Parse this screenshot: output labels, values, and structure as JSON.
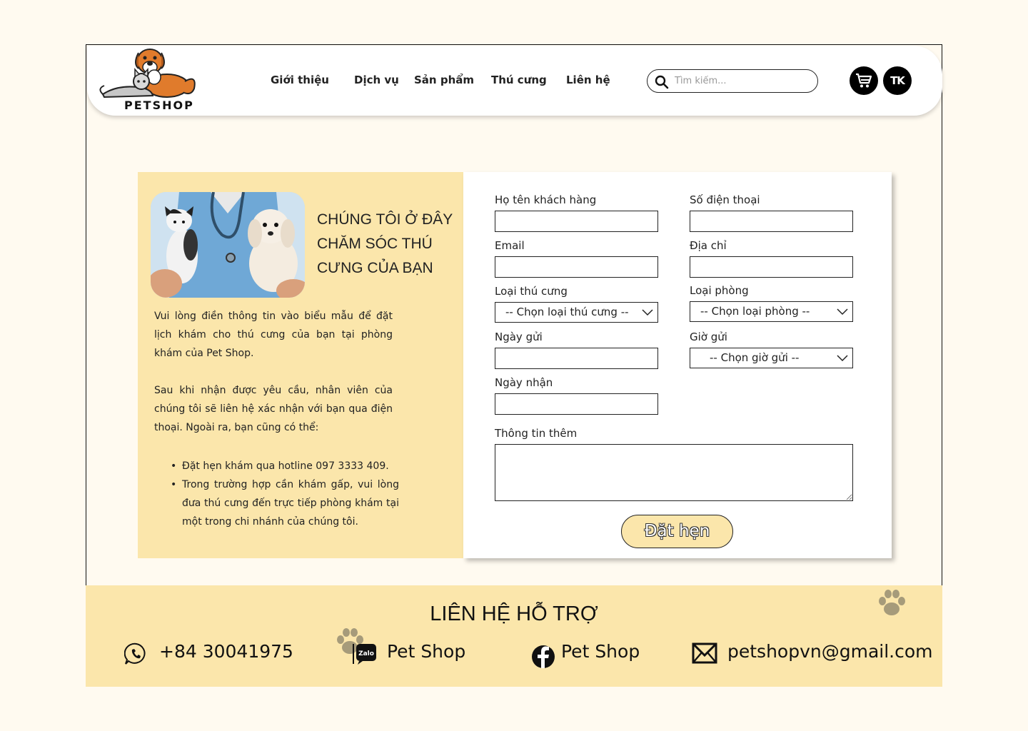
{
  "header": {
    "logo_text": "PETSHOP",
    "nav": [
      "Giới thiệu",
      "Dịch vụ",
      "Sản phẩm",
      "Thú cưng",
      "Liên hệ"
    ],
    "search_placeholder": "Tìm kiếm...",
    "account_label": "TK"
  },
  "info": {
    "headline": "CHÚNG TÔI Ở ĐÂY CHĂM SÓC THÚ CƯNG CỦA BẠN",
    "para1": "Vui lòng điền thông tin vào biểu mẫu để đặt lịch khám cho thú cưng của bạn tại phòng khám của Pet Shop.",
    "para2": "Sau khi nhận được yêu cầu, nhân viên của chúng tôi sẽ liên hệ xác nhận với bạn qua điện thoại. Ngoài ra, bạn cũng có thể:",
    "bullets": [
      "Đặt hẹn khám qua hotline 097 3333 409.",
      "Trong trường hợp cần khám gấp, vui lòng đưa thú cưng đến trực tiếp phòng khám tại một trong chi nhánh của chúng tôi."
    ]
  },
  "form": {
    "name_label": "Họ tên khách hàng",
    "phone_label": "Số điện thoại",
    "email_label": "Email",
    "address_label": "Địa chỉ",
    "pet_type_label": "Loại thú cưng",
    "pet_type_value": "-- Chọn loại thú cưng --",
    "room_type_label": "Loại phòng",
    "room_type_value": "-- Chọn loại phòng --",
    "send_date_label": "Ngày gửi",
    "send_time_label": "Giờ gửi",
    "send_time_value": "-- Chọn giờ gửi --",
    "receive_date_label": "Ngày nhận",
    "notes_label": "Thông tin thêm",
    "submit_label": "Đặt hẹn"
  },
  "footer": {
    "title": "LIÊN HỆ HỖ TRỢ",
    "phone": "+84 30041975",
    "zalo_badge": "Zalo",
    "zalo": "Pet Shop",
    "facebook": "Pet Shop",
    "email": "petshopvn@gmail.com"
  },
  "colors": {
    "background": "#fffaf0",
    "accent": "#fbe6ab",
    "paw": "#a69b7a"
  }
}
